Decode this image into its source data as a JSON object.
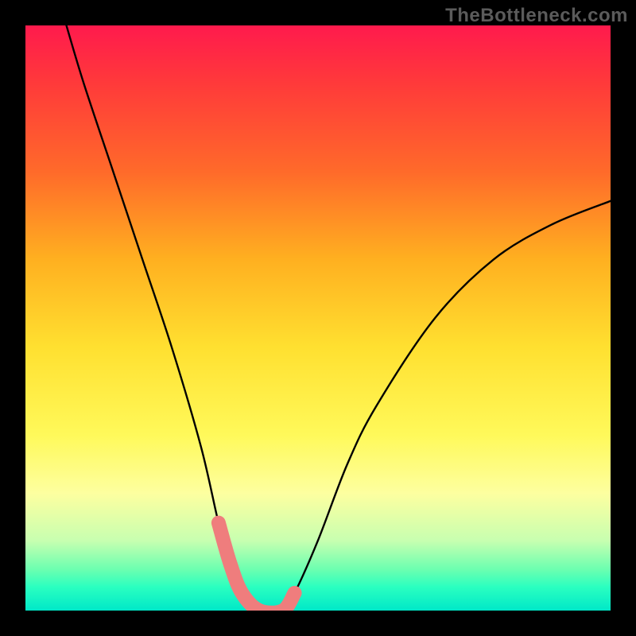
{
  "watermark": {
    "text": "TheBottleneck.com"
  },
  "chart_data": {
    "type": "line",
    "title": "",
    "xlabel": "",
    "ylabel": "",
    "x_range": [
      0,
      100
    ],
    "y_range_percent": [
      0,
      100
    ],
    "series": [
      {
        "name": "bottleneck-curve",
        "color": "#000000",
        "x": [
          7,
          10,
          15,
          20,
          25,
          30,
          33,
          35,
          37,
          40,
          44,
          46,
          50,
          55,
          60,
          70,
          80,
          90,
          100
        ],
        "y_pct": [
          100,
          90,
          75,
          60,
          45,
          28,
          15,
          8,
          3,
          0,
          0,
          3,
          12,
          25,
          35,
          50,
          60,
          66,
          70
        ]
      }
    ],
    "highlight": {
      "name": "optimal-range",
      "color": "#ef7d7d",
      "points_x": [
        33,
        35,
        37,
        40,
        44,
        46
      ],
      "points_y_pct": [
        15,
        8,
        3,
        0,
        0,
        3
      ]
    },
    "gradient_stops": [
      {
        "pct": 0,
        "color": "#ff1a4d"
      },
      {
        "pct": 55,
        "color": "#ffe030"
      },
      {
        "pct": 80,
        "color": "#fdffa0"
      },
      {
        "pct": 100,
        "color": "#00e8c8"
      }
    ]
  }
}
